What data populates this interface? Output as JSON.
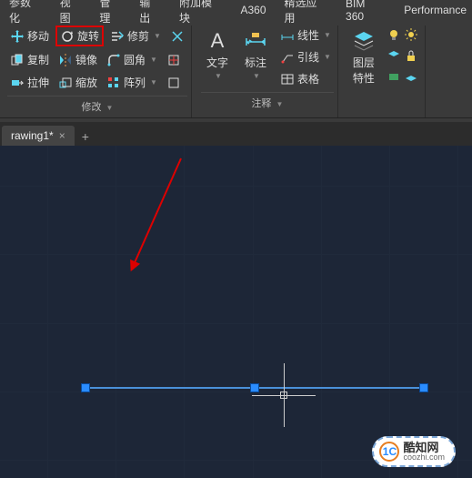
{
  "menubar": [
    "参数化",
    "视图",
    "管理",
    "输出",
    "附加模块",
    "A360",
    "精选应用",
    "BIM 360",
    "Performance"
  ],
  "ribbon": {
    "modify": {
      "move": "移动",
      "rotate": "旋转",
      "trim": "修剪",
      "copy": "复制",
      "mirror": "镜像",
      "fillet": "圆角",
      "stretch": "拉伸",
      "scale": "缩放",
      "array": "阵列",
      "title": "修改"
    },
    "annot": {
      "text": "文字",
      "dim": "标注",
      "linear": "线性",
      "leader": "引线",
      "table": "表格",
      "title": "注释"
    },
    "layers": {
      "props": "图层\n特性"
    }
  },
  "tabs": {
    "active": "rawing1*",
    "close": "×",
    "add": "+"
  },
  "watermark": {
    "logo": "1C",
    "cn": "酷知网",
    "en": "coozhi.com"
  }
}
